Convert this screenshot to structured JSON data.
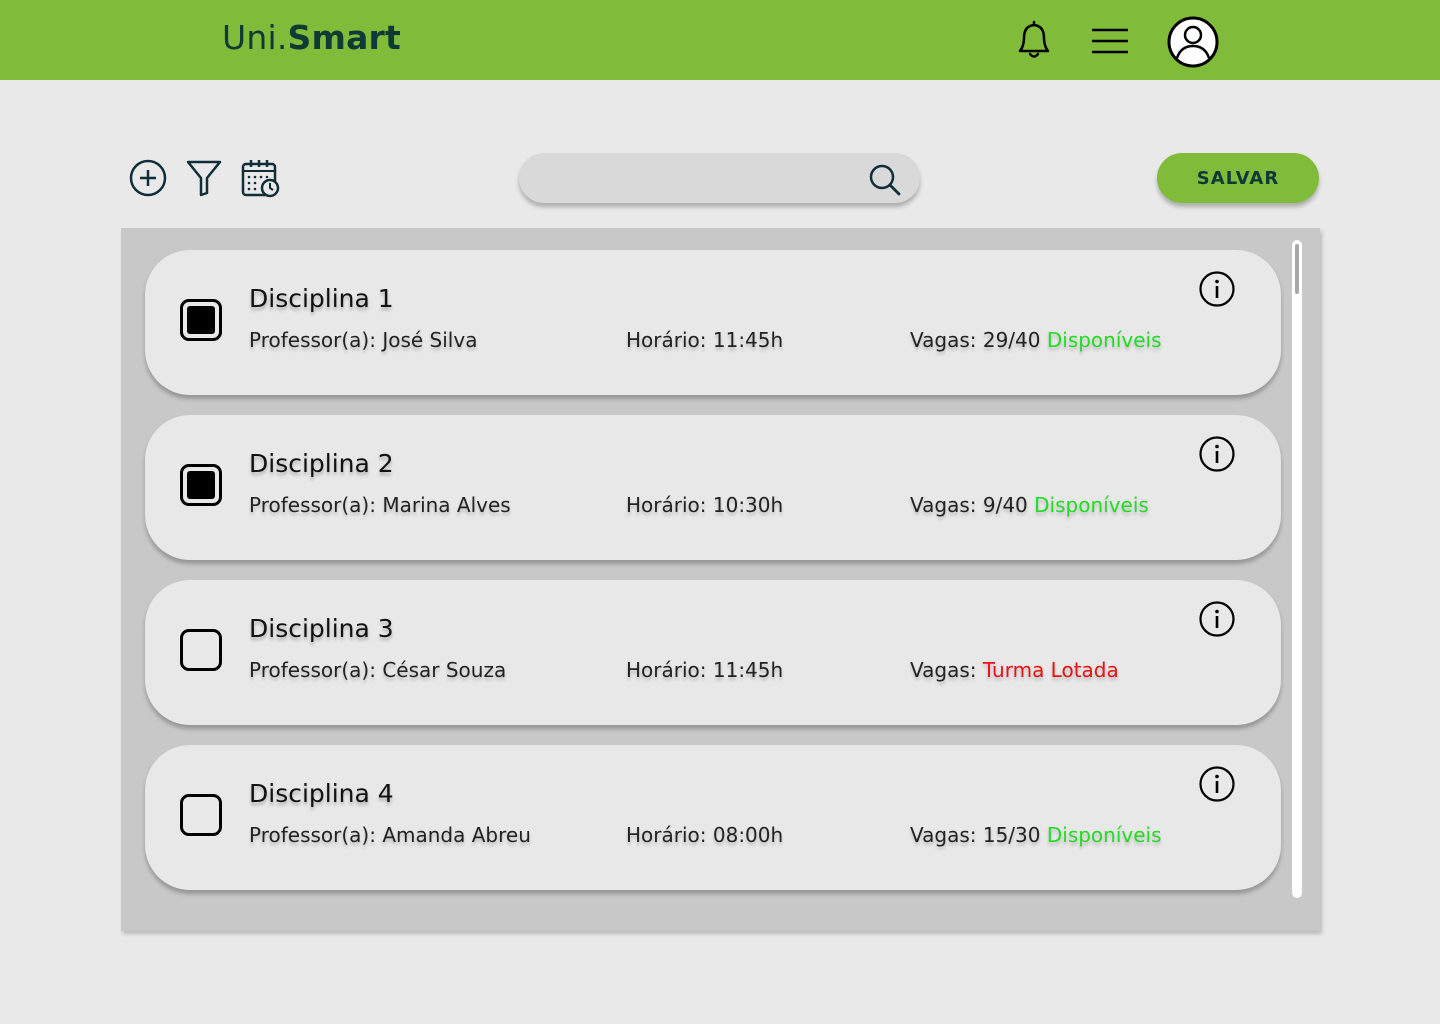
{
  "header": {
    "logo_light": "Uni.",
    "logo_bold": "Smart",
    "icons": [
      "bell-icon",
      "hamburger-menu-icon",
      "user-profile-icon"
    ],
    "color": "#80bc39"
  },
  "toolbar": {
    "icons": [
      "add-circle-icon",
      "filter-icon",
      "calendar-clock-icon"
    ],
    "search": {
      "value": "",
      "placeholder": ""
    },
    "save_label": "SALVAR"
  },
  "colors": {
    "available": "#22dd22",
    "full": "#ee1111",
    "brand_dark": "#0f3b36"
  },
  "courses": [
    {
      "title": "Disciplina 1",
      "professor": "Professor(a): José Silva",
      "schedule": "Horário: 11:45h",
      "vagas_label": "Vagas: ",
      "vagas_count": "29/40 ",
      "status": "Disponíveis",
      "checked": true
    },
    {
      "title": "Disciplina 2",
      "professor": "Professor(a): Marina Alves",
      "schedule": "Horário: 10:30h",
      "vagas_label": "Vagas: ",
      "vagas_count": "9/40 ",
      "status": "Disponíveis",
      "checked": true
    },
    {
      "title": "Disciplina 3",
      "professor": "Professor(a): César Souza",
      "schedule": "Horário: 11:45h",
      "vagas_label": "Vagas: ",
      "vagas_count": "",
      "status": "Turma Lotada",
      "checked": false
    },
    {
      "title": "Disciplina 4",
      "professor": "Professor(a): Amanda Abreu",
      "schedule": "Horário: 08:00h",
      "vagas_label": "Vagas: ",
      "vagas_count": "15/30 ",
      "status": "Disponíveis",
      "checked": false
    }
  ]
}
